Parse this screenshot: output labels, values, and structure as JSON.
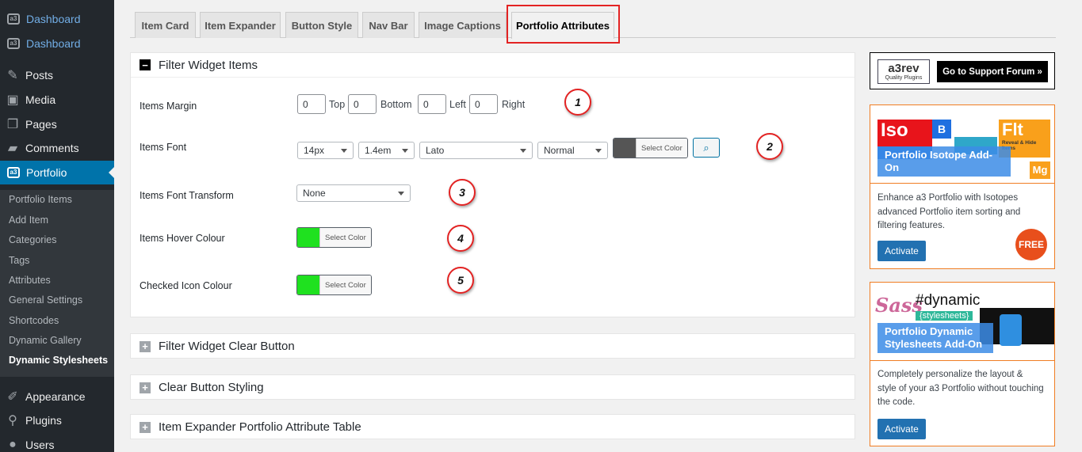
{
  "sidebar": {
    "top_items": [
      {
        "label": "Dashboard",
        "icon": "a3-icon"
      },
      {
        "label": "Dashboard",
        "icon": "a3-icon"
      },
      {
        "label": "Posts",
        "icon": "pin-icon"
      },
      {
        "label": "Media",
        "icon": "media-icon"
      },
      {
        "label": "Pages",
        "icon": "pages-icon"
      },
      {
        "label": "Comments",
        "icon": "comment-icon"
      },
      {
        "label": "Portfolio",
        "icon": "a3-icon"
      }
    ],
    "sub_items": [
      "Portfolio Items",
      "Add Item",
      "Categories",
      "Tags",
      "Attributes",
      "General Settings",
      "Shortcodes",
      "Dynamic Gallery",
      "Dynamic Stylesheets"
    ],
    "bottom_items": [
      {
        "label": "Appearance",
        "icon": "brush-icon"
      },
      {
        "label": "Plugins",
        "icon": "plugin-icon"
      },
      {
        "label": "Users",
        "icon": "users-icon"
      }
    ]
  },
  "tabs": [
    "Item Card",
    "Item Expander",
    "Button Style",
    "Nav Bar",
    "Image Captions",
    "Portfolio Attributes"
  ],
  "panel1": {
    "title": "Filter Widget Items",
    "margin_label": "Items Margin",
    "margin": [
      {
        "value": "0",
        "label": "Top"
      },
      {
        "value": "0",
        "label": "Bottom"
      },
      {
        "value": "0",
        "label": "Left"
      },
      {
        "value": "0",
        "label": "Right"
      }
    ],
    "font_label": "Items Font",
    "font_size": "14px",
    "line_height": "1.4em",
    "font_family": "Lato",
    "font_weight": "Normal",
    "font_color_label": "Select Color",
    "font_color": "#555555",
    "transform_label": "Items Font Transform",
    "transform_value": "None",
    "hover_label": "Items Hover Colour",
    "hover_color": "#1fe11f",
    "hover_color_label": "Select Color",
    "checked_label": "Checked Icon Colour",
    "checked_color": "#1fe11f",
    "checked_color_label": "Select Color"
  },
  "markers": [
    "1",
    "2",
    "3",
    "4",
    "5"
  ],
  "collapsed_panels": [
    "Filter Widget Clear Button",
    "Clear Button Styling",
    "Item Expander Portfolio Attribute Table"
  ],
  "support": {
    "logo": "a3rev",
    "logo_sub": "Quality Plugins",
    "button": "Go to Support Forum »"
  },
  "addon1": {
    "title": "Portfolio Isotope Add-On",
    "tiles": [
      "Iso",
      "B",
      "Flt",
      "Reveal & Hide Items",
      "Mg"
    ],
    "desc": "Enhance a3 Portfolio with Isotopes advanced Portfolio item sorting and filtering features.",
    "badge": "FREE",
    "button": "Activate"
  },
  "addon2": {
    "title": "Portfolio Dynamic Stylesheets Add-On",
    "tag": "#dynamic",
    "tag_sub": "{stylesheets}",
    "logo": "Sass",
    "desc": "Completely personalize the layout & style of your a3 Portfolio without touching the code.",
    "button": "Activate"
  }
}
